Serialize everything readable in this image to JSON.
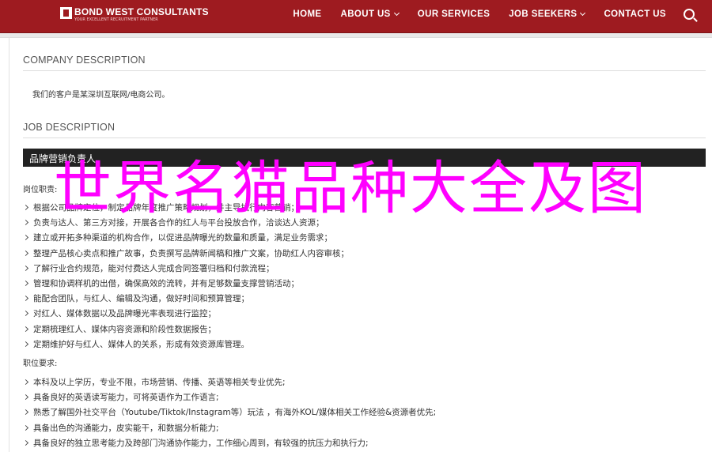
{
  "brand": {
    "name": "BOND WEST CONSULTANTS",
    "tagline": "YOUR EXCELLENT RECRUITMENT PARTNER"
  },
  "nav": {
    "items": [
      {
        "label": "HOME",
        "dropdown": false
      },
      {
        "label": "ABOUT US",
        "dropdown": true
      },
      {
        "label": "OUR SERVICES",
        "dropdown": false
      },
      {
        "label": "JOB SEEKERS",
        "dropdown": true
      },
      {
        "label": "CONTACT US",
        "dropdown": false
      }
    ]
  },
  "company": {
    "heading": "COMPANY DESCRIPTION",
    "text": "我们的客户是某深圳互联网/电商公司。"
  },
  "job": {
    "heading": "JOB DESCRIPTION",
    "title_bar": "品牌营销负责人",
    "duties_label": "岗位职责:",
    "duties": [
      "根据公司品牌定位，制定品牌年度推广策略规划，并主导执行内容营销；",
      "负责与达人、第三方对接，开展各合作的红人与平台投放合作，洽谈达人资源；",
      "建立或开拓多种渠道的机构合作，以促进品牌曝光的数量和质量，满足业务需求；",
      "整理产品核心卖点和推广故事，负责撰写品牌新闻稿和推广文案，协助红人内容审核；",
      "了解行业合约规范，能对付费达人完成合同签署归档和付款流程；",
      "管理和协调样机的出借，确保高效的流转，并有足够数量支撑营销活动；",
      "能配合团队，与红人、编辑及沟通，做好时间和预算管理；",
      "对红人、媒体数据以及品牌曝光率表现进行监控；",
      "定期梳理红人、媒体内容资源和阶段性数据报告；",
      "定期维护好与红人、媒体人的关系，形成有效资源库管理。"
    ],
    "req_label": "职位要求:",
    "requirements": [
      "本科及以上学历，专业不限，市场营销、传播、英语等相关专业优先;",
      "具备良好的英语读写能力，可将英语作为工作语言;",
      "熟悉了解国外社交平台（Youtube/Tiktok/Instagram等）玩法 ，有海外KOL/媒体相关工作经验&资源者优先;",
      "具备出色的沟通能力，皮实能干，和数据分析能力;",
      "具备良好的独立思考能力及跨部门沟通协作能力，工作细心周到，有较强的抗压力和执行力;"
    ]
  },
  "watermark": {
    "text": "世界名猫品种大全及图",
    "color": "#ff00ff"
  }
}
